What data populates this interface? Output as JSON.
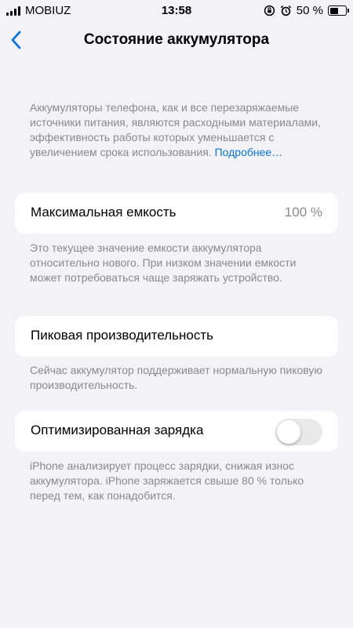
{
  "status_bar": {
    "carrier": "MOBIUZ",
    "time": "13:58",
    "battery_percent": "50 %",
    "battery_level": 0.5
  },
  "nav": {
    "title": "Состояние аккумулятора"
  },
  "intro": {
    "text": "Аккумуляторы телефона, как и все перезаряжаемые источники питания, являются расходными материалами, эффективность работы которых уменьшается с увеличением срока использования.",
    "link": "Подробнее…"
  },
  "max_capacity": {
    "label": "Максимальная емкость",
    "value": "100 %",
    "footer": "Это текущее значение емкости аккумулятора относительно нового. При низком значении емкости может потребоваться чаще заряжать устройство."
  },
  "peak_performance": {
    "label": "Пиковая производительность",
    "footer": "Сейчас аккумулятор поддерживает нормальную пиковую производительность."
  },
  "optimized_charging": {
    "label": "Оптимизированная зарядка",
    "enabled": false,
    "footer": "iPhone анализирует процесс зарядки, снижая износ аккумулятора. iPhone заряжается свыше 80 % только перед тем, как понадобится."
  }
}
